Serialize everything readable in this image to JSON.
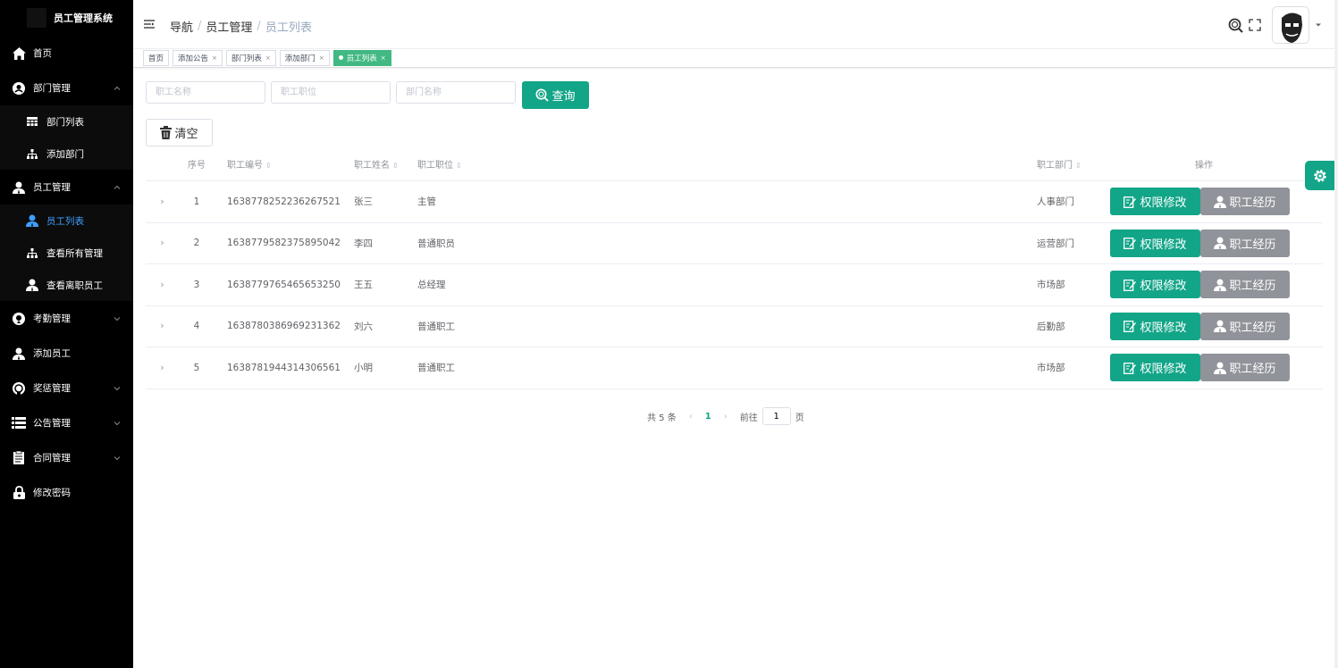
{
  "sidebar": {
    "brand": "员工管理系统",
    "items": [
      {
        "label": "首页",
        "icon": "home-icon"
      },
      {
        "label": "部门管理",
        "icon": "department-icon",
        "expanded": true,
        "children": [
          {
            "label": "部门列表",
            "icon": "table-icon"
          },
          {
            "label": "添加部门",
            "icon": "sitemap-icon"
          }
        ]
      },
      {
        "label": "员工管理",
        "icon": "user-icon",
        "expanded": true,
        "children": [
          {
            "label": "员工列表",
            "icon": "user-icon",
            "active": true
          },
          {
            "label": "查看所有管理",
            "icon": "sitemap-icon"
          },
          {
            "label": "查看离职员工",
            "icon": "user-icon"
          }
        ]
      },
      {
        "label": "考勤管理",
        "icon": "pin-icon"
      },
      {
        "label": "添加员工",
        "icon": "user-icon"
      },
      {
        "label": "奖惩管理",
        "icon": "medal-icon"
      },
      {
        "label": "公告管理",
        "icon": "list-icon"
      },
      {
        "label": "合同管理",
        "icon": "document-icon"
      },
      {
        "label": "修改密码",
        "icon": "lock-icon"
      }
    ]
  },
  "header": {
    "breadcrumb": [
      "导航",
      "员工管理",
      "员工列表"
    ]
  },
  "tags": [
    {
      "label": "首页",
      "closable": false
    },
    {
      "label": "添加公告",
      "closable": true
    },
    {
      "label": "部门列表",
      "closable": true
    },
    {
      "label": "添加部门",
      "closable": true
    },
    {
      "label": "员工列表",
      "closable": true,
      "active": true
    }
  ],
  "search": {
    "name_placeholder": "职工名称",
    "position_placeholder": "职工职位",
    "dept_placeholder": "部门名称",
    "query_label": "查询",
    "clear_label": "清空"
  },
  "table": {
    "headers": {
      "index": "序号",
      "id": "职工编号",
      "name": "职工姓名",
      "position": "职工职位",
      "dept": "职工部门",
      "ops": "操作"
    },
    "rows": [
      {
        "index": "1",
        "id": "1638778252236267521",
        "name": "张三",
        "position": "主管",
        "dept": "人事部门"
      },
      {
        "index": "2",
        "id": "1638779582375895042",
        "name": "李四",
        "position": "普通职员",
        "dept": "运营部门"
      },
      {
        "index": "3",
        "id": "1638779765465653250",
        "name": "王五",
        "position": "总经理",
        "dept": "市场部"
      },
      {
        "index": "4",
        "id": "1638780386969231362",
        "name": "刘六",
        "position": "普通职工",
        "dept": "后勤部"
      },
      {
        "index": "5",
        "id": "1638781944314306561",
        "name": "小明",
        "position": "普通职工",
        "dept": "市场部"
      }
    ],
    "perm_label": "权限修改",
    "history_label": "职工经历"
  },
  "pagination": {
    "total": "共 5 条",
    "current": "1",
    "goto_label": "前往",
    "goto_value": "1",
    "page_suffix": "页"
  },
  "colors": {
    "accent": "#13a588",
    "sidebar_bg": "#000000",
    "active_menu": "#409eff",
    "tag_active": "#42b983",
    "gray_button": "#909399"
  }
}
